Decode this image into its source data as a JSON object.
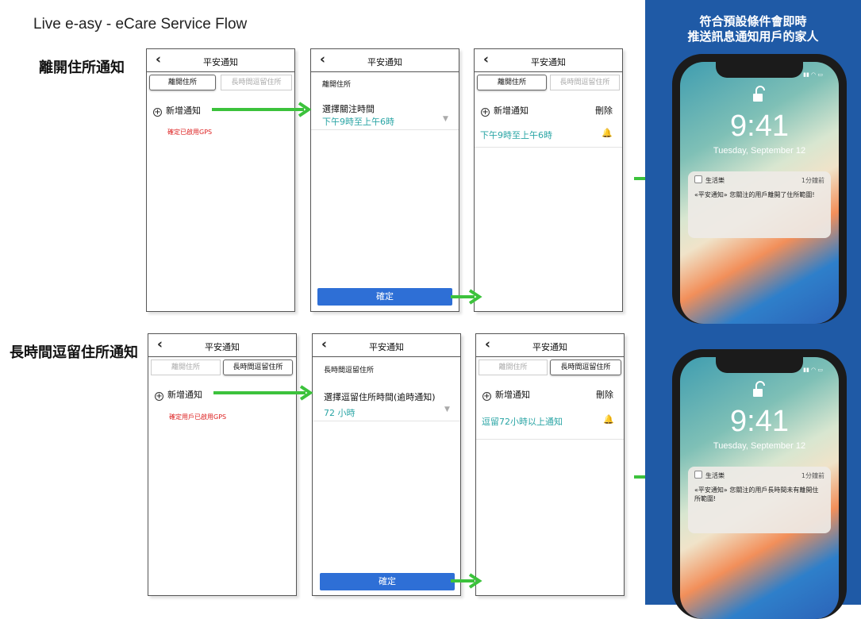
{
  "title": "Live e-asy - eCare Service Flow",
  "panel_title_1": "符合預設條件會即時",
  "panel_title_2": "推送訊息通知用戶的家人",
  "row1": {
    "label": "離開住所通知",
    "s1": {
      "header": "平安通知",
      "tab1": "離開住所",
      "tab2": "長時間逗留住所",
      "add": "新增通知",
      "warning": "確定已啟用GPS"
    },
    "s2": {
      "header": "平安通知",
      "section": "離開住所",
      "field_label": "選擇關注時間",
      "field_value": "下午9時至上午6時",
      "confirm": "確定"
    },
    "s3": {
      "header": "平安通知",
      "tab1": "離開住所",
      "tab2": "長時間逗留住所",
      "add": "新增通知",
      "delete": "刪除",
      "entry": "下午9時至上午6時"
    }
  },
  "row2": {
    "label": "長時間逗留住所通知",
    "s1": {
      "header": "平安通知",
      "tab1": "離開住所",
      "tab2": "長時間逗留住所",
      "add": "新增通知",
      "warning": "確定用戶已啟用GPS"
    },
    "s2": {
      "header": "平安通知",
      "section": "長時間逗留住所",
      "field_label": "選擇逗留住所時間(逾時通知)",
      "field_value": "72 小時",
      "confirm": "確定"
    },
    "s3": {
      "header": "平安通知",
      "tab1": "離開住所",
      "tab2": "長時間逗留住所",
      "add": "新增通知",
      "delete": "刪除",
      "entry": "逗留72小時以上通知"
    }
  },
  "phone1": {
    "time": "9:41",
    "date": "Tuesday, September 12",
    "app": "生活樂",
    "ago": "1分鐘前",
    "message": "«平安通知» 您關注的用戶離開了住所範圍!"
  },
  "phone2": {
    "time": "9:41",
    "date": "Tuesday, September 12",
    "app": "生活樂",
    "ago": "1分鐘前",
    "message": "«平安通知» 您關注的用戶長時間未有離開住所範圍!"
  },
  "colors": {
    "arrow": "#3cc23c",
    "confirm_button": "#2e6fd6",
    "panel": "#1f5aa6",
    "teal_text": "#2aa5a5",
    "warning": "#dd2222"
  }
}
